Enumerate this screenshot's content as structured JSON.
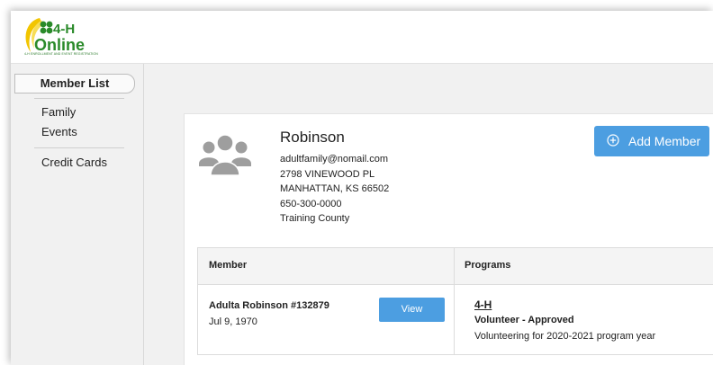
{
  "brand": {
    "logo_text": "4-H",
    "logo_text2": "Online",
    "tagline": "4-H ENROLLMENT AND EVENT REGISTRATION"
  },
  "sidebar": {
    "active": "Member List",
    "items": [
      "Family",
      "Events",
      "Credit Cards"
    ]
  },
  "family": {
    "name": "Robinson",
    "email": "adultfamily@nomail.com",
    "address1": "2798 VINEWOOD PL",
    "address2": "MANHATTAN, KS 66502",
    "phone": "650-300-0000",
    "county": "Training County"
  },
  "actions": {
    "add_member": "Add Member"
  },
  "table": {
    "headers": [
      "Member",
      "Programs"
    ],
    "rows": [
      {
        "member": "Adulta Robinson #132879",
        "dob": "Jul 9, 1970",
        "view": "View",
        "program": "4-H",
        "status": "Volunteer - Approved",
        "description": "Volunteering for 2020-2021 program year"
      }
    ]
  },
  "colors": {
    "accent": "#4c9ee1",
    "logo_green": "#2a8a2a",
    "logo_yellow": "#f2c500",
    "avatar": "#9e9e9e"
  }
}
